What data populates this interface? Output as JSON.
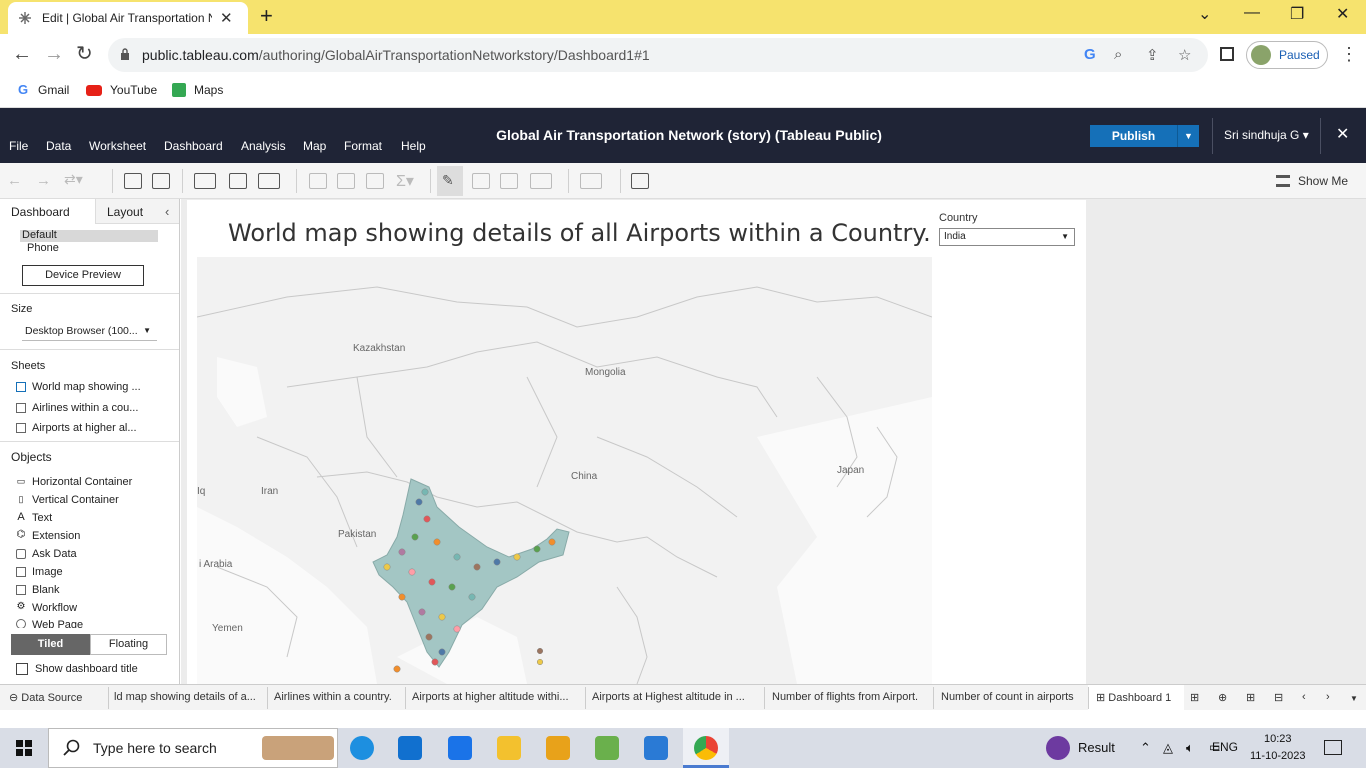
{
  "browser": {
    "tab_title": "Edit | Global Air Transportation N",
    "url_host": "public.tableau.com",
    "url_path": "/authoring/GlobalAirTransportationNetworkstory/Dashboard1#1",
    "profile_status": "Paused",
    "bookmarks": [
      "Gmail",
      "YouTube",
      "Maps"
    ]
  },
  "app": {
    "menu": [
      "File",
      "Data",
      "Worksheet",
      "Dashboard",
      "Analysis",
      "Map",
      "Format",
      "Help"
    ],
    "title": "Global Air Transportation Network (story) (Tableau Public)",
    "publish_label": "Publish",
    "user": "Sri sindhuja G",
    "show_me": "Show Me"
  },
  "left_pane": {
    "tabs": [
      "Dashboard",
      "Layout"
    ],
    "device_options": [
      "Default",
      "Phone"
    ],
    "device_preview": "Device Preview",
    "size_heading": "Size",
    "size_value": "Desktop Browser (100...",
    "sheets_heading": "Sheets",
    "sheets": [
      "World map showing ...",
      "Airlines within a cou...",
      "Airports at higher al..."
    ],
    "objects_heading": "Objects",
    "objects": [
      "Horizontal Container",
      "Vertical Container",
      "Text",
      "Extension",
      "Ask Data",
      "Image",
      "Blank",
      "Workflow",
      "Web Page"
    ],
    "tiled": "Tiled",
    "floating": "Floating",
    "show_title": "Show dashboard title"
  },
  "dashboard": {
    "title": "World map showing details of all Airports within a Country.",
    "filter_label": "Country",
    "filter_value": "India",
    "map_labels": [
      "Kazakhstan",
      "Mongolia",
      "China",
      "Japan",
      "Iran",
      "Pakistan",
      "i Arabia",
      "Yemen",
      "Iq"
    ]
  },
  "sheet_tabs": [
    "Data Source",
    "ld map showing details of a...",
    "Airlines within a country.",
    "Airports at higher altitude withi...",
    "Airports at Highest altitude in ...",
    "Number of flights from Airport.",
    "Number of count in airports",
    "Dashboard 1"
  ],
  "taskbar": {
    "search_placeholder": "Type here to search",
    "result_label": "Result",
    "lang": "ENG",
    "time": "10:23",
    "date": "11-10-2023"
  }
}
